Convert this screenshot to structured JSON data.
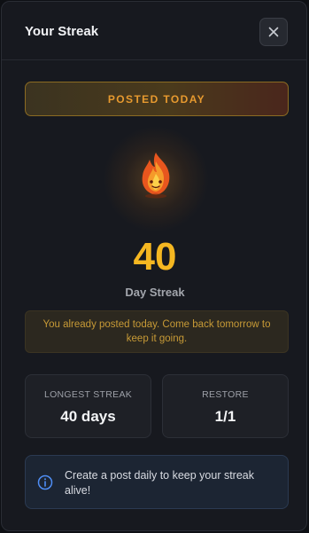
{
  "modal": {
    "title": "Your Streak",
    "close_icon": "close-icon"
  },
  "status": {
    "banner": "POSTED TODAY"
  },
  "streak": {
    "icon": "flame-icon",
    "count": "40",
    "label": "Day Streak",
    "notice": "You already posted today. Come back tomorrow to keep it going."
  },
  "stats": {
    "longest_label": "LONGEST STREAK",
    "longest_value": "40 days",
    "restore_label": "RESTORE",
    "restore_value": "1/1"
  },
  "tip": {
    "icon": "info-icon",
    "text": "Create a post daily to keep your streak alive!"
  },
  "colors": {
    "accent": "#f5b721",
    "banner_text": "#e79a2f",
    "tip_border": "#2b3a52"
  }
}
